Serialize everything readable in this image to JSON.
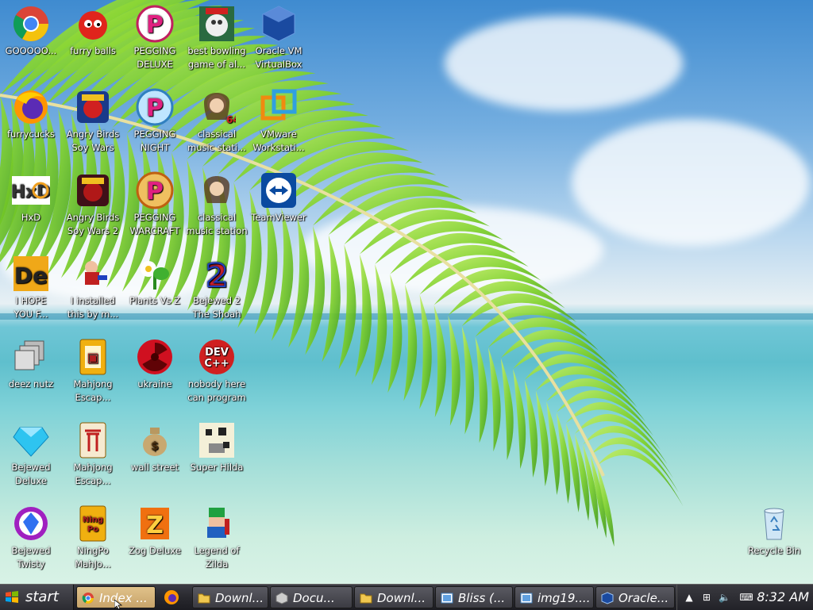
{
  "desktop": {
    "wallpaper": "Tropical beach with palm leaf",
    "icons": [
      {
        "name": "chrome-icon",
        "label": "GOOOOO..."
      },
      {
        "name": "furry-balls-icon",
        "label": "furry balls"
      },
      {
        "name": "pegging-deluxe-icon",
        "label": "PEGGING\nDELUXE"
      },
      {
        "name": "bowling-icon",
        "label": "best bowling\ngame of al..."
      },
      {
        "name": "virtualbox-icon",
        "label": "Oracle VM\nVirtualBox"
      },
      {
        "name": "firefox-icon",
        "label": "furrycucks"
      },
      {
        "name": "angry-birds-icon",
        "label": "Angry Birds\nSoy Wars"
      },
      {
        "name": "pegging-night-icon",
        "label": "PEGGING\nNIGHT"
      },
      {
        "name": "classical-music-icon",
        "label": "classical\nmusic stati..."
      },
      {
        "name": "vmware-icon",
        "label": "VMware\nWorkstati..."
      },
      {
        "name": "hxd-icon",
        "label": "HxD"
      },
      {
        "name": "angry-birds-2-icon",
        "label": "Angry Birds\nSoy Wars 2"
      },
      {
        "name": "pegging-warcraft-icon",
        "label": "PEGGING\nWARCRAFT"
      },
      {
        "name": "classical-music-2-icon",
        "label": "classical\nmusic station"
      },
      {
        "name": "teamviewer-icon",
        "label": "TeamViewer"
      },
      {
        "name": "de-icon",
        "label": "I HOPE\nYOU F..."
      },
      {
        "name": "installed-icon",
        "label": "I installed\nthis by m..."
      },
      {
        "name": "plants-vs-z-icon",
        "label": "Plants Vs Z"
      },
      {
        "name": "bejewed-2-icon",
        "label": "Bejewed 2\nThe Shoah"
      },
      {
        "name": "deez-nutz-icon",
        "label": "deez nutz"
      },
      {
        "name": "mahjong-icon",
        "label": "Mahjong\nEscap..."
      },
      {
        "name": "ukraine-icon",
        "label": "ukraine"
      },
      {
        "name": "dev-cpp-icon",
        "label": "nobody here\ncan program"
      },
      {
        "name": "bejewed-deluxe-icon",
        "label": "Bejewed\nDeluxe"
      },
      {
        "name": "mahjong-2-icon",
        "label": "Mahjong\nEscap..."
      },
      {
        "name": "wall-street-icon",
        "label": "wall street"
      },
      {
        "name": "super-hilda-icon",
        "label": "Super Hilda"
      },
      {
        "name": "bejewed-twisty-icon",
        "label": "Bejewed\nTwisty"
      },
      {
        "name": "ningpo-icon",
        "label": "NingPo\nMahJo..."
      },
      {
        "name": "zog-deluxe-icon",
        "label": "Zog Deluxe"
      },
      {
        "name": "legend-of-zilda-icon",
        "label": "Legend of\nZilda"
      },
      {
        "name": "recycle-bin-icon",
        "label": "Recycle Bin"
      }
    ]
  },
  "taskbar": {
    "start_label": "start",
    "tasks": [
      {
        "name": "task-chrome",
        "label": "Index ...",
        "icon": "chrome-icon",
        "active": true
      },
      {
        "name": "task-download-1",
        "label": "Downl...",
        "icon": "folder-icon",
        "active": false
      },
      {
        "name": "task-documents",
        "label": "Docu...",
        "icon": "box-icon",
        "active": false
      },
      {
        "name": "task-download-2",
        "label": "Downl...",
        "icon": "folder-icon",
        "active": false
      },
      {
        "name": "task-bliss",
        "label": "Bliss (...",
        "icon": "image-icon",
        "active": false
      },
      {
        "name": "task-img",
        "label": "img19....",
        "icon": "image-icon",
        "active": false
      },
      {
        "name": "task-oracle",
        "label": "Oracle...",
        "icon": "virtualbox-icon",
        "active": false
      }
    ],
    "clock": "8:32 AM"
  }
}
